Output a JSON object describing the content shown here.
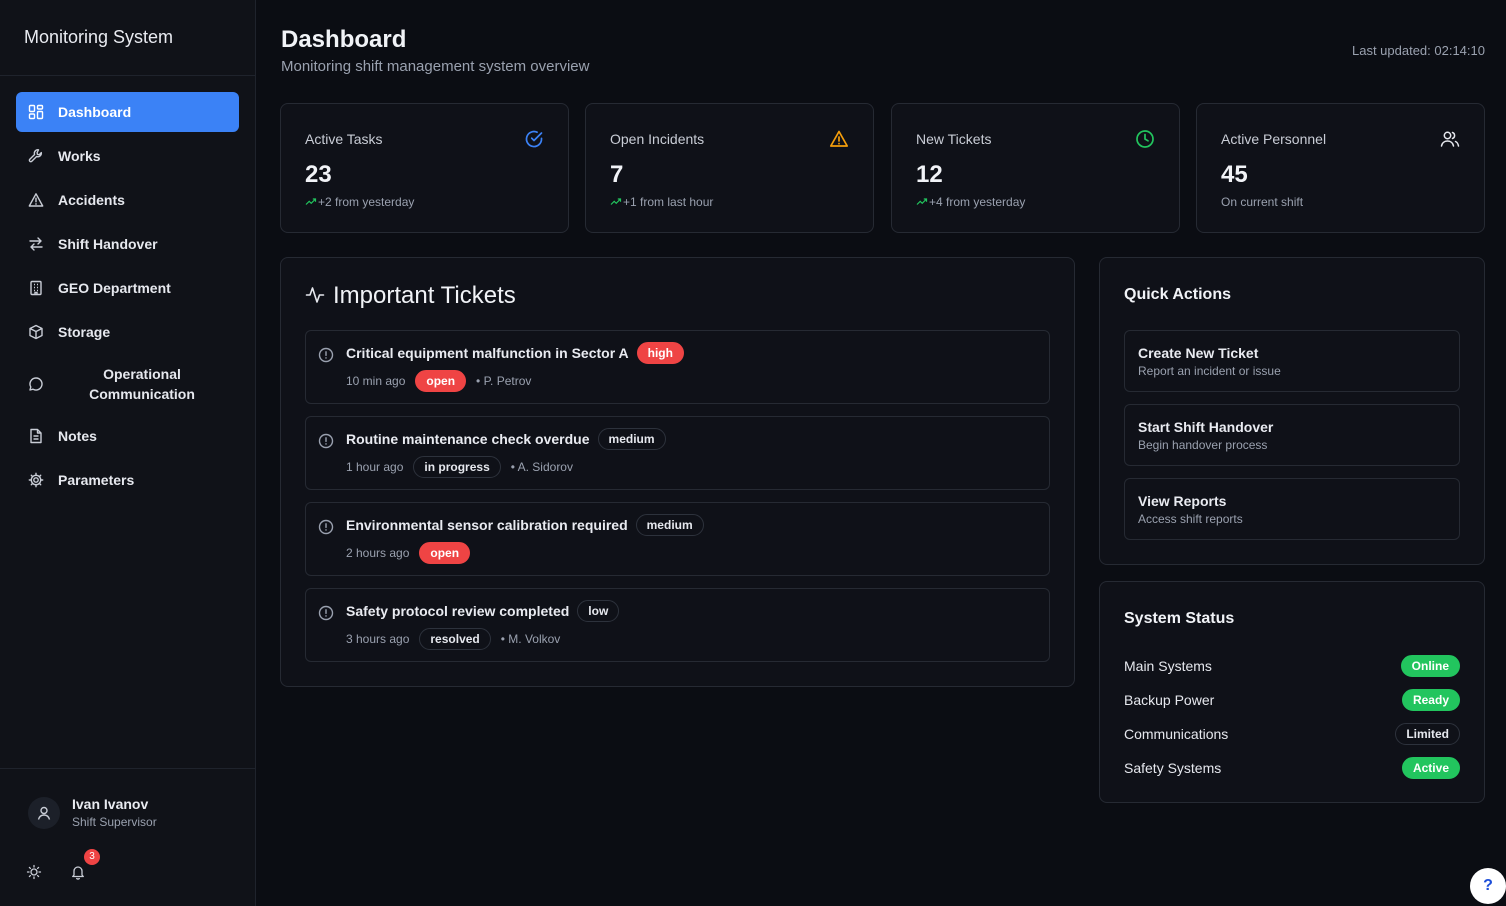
{
  "app": {
    "title": "Monitoring System"
  },
  "sidebar": {
    "items": [
      {
        "label": "Dashboard",
        "icon": "dashboard-icon",
        "active": true
      },
      {
        "label": "Works",
        "icon": "wrench-icon"
      },
      {
        "label": "Accidents",
        "icon": "warning-icon"
      },
      {
        "label": "Shift Handover",
        "icon": "arrows-swap-icon"
      },
      {
        "label": "GEO Department",
        "icon": "building-icon"
      },
      {
        "label": "Storage",
        "icon": "package-icon"
      },
      {
        "label": "Operational Communication",
        "icon": "message-icon"
      },
      {
        "label": "Notes",
        "icon": "document-icon"
      },
      {
        "label": "Parameters",
        "icon": "gear-icon"
      }
    ],
    "user": {
      "name": "Ivan Ivanov",
      "role": "Shift Supervisor"
    },
    "notifications_count": "3"
  },
  "header": {
    "title": "Dashboard",
    "subtitle": "Monitoring shift management system overview",
    "last_updated": "Last updated: 02:14:10"
  },
  "stats": [
    {
      "title": "Active Tasks",
      "value": "23",
      "sub": "+2 from yesterday",
      "trend": true,
      "icon": "check-circle-icon",
      "color": "#3b82f6"
    },
    {
      "title": "Open Incidents",
      "value": "7",
      "sub": "+1 from last hour",
      "trend": true,
      "icon": "warning-icon",
      "color": "#f59e0b"
    },
    {
      "title": "New Tickets",
      "value": "12",
      "sub": "+4 from yesterday",
      "trend": true,
      "icon": "clock-icon",
      "color": "#22c55e"
    },
    {
      "title": "Active Personnel",
      "value": "45",
      "sub": "On current shift",
      "trend": false,
      "icon": "users-icon",
      "color": "#e6e8ee"
    }
  ],
  "tickets": {
    "title": "Important Tickets",
    "items": [
      {
        "title": "Critical equipment malfunction in Sector A",
        "priority": "high",
        "priority_style": "red",
        "time": "10 min ago",
        "status": "open",
        "status_style": "red",
        "assignee": "• P. Petrov"
      },
      {
        "title": "Routine maintenance check overdue",
        "priority": "medium",
        "priority_style": "outline",
        "time": "1 hour ago",
        "status": "in progress",
        "status_style": "outline",
        "assignee": "• A. Sidorov"
      },
      {
        "title": "Environmental sensor calibration required",
        "priority": "medium",
        "priority_style": "outline",
        "time": "2 hours ago",
        "status": "open",
        "status_style": "red",
        "assignee": ""
      },
      {
        "title": "Safety protocol review completed",
        "priority": "low",
        "priority_style": "outline",
        "time": "3 hours ago",
        "status": "resolved",
        "status_style": "outline",
        "assignee": "• M. Volkov"
      }
    ]
  },
  "quick_actions": {
    "title": "Quick Actions",
    "items": [
      {
        "title": "Create New Ticket",
        "desc": "Report an incident or issue"
      },
      {
        "title": "Start Shift Handover",
        "desc": "Begin handover process"
      },
      {
        "title": "View Reports",
        "desc": "Access shift reports"
      }
    ]
  },
  "system_status": {
    "title": "System Status",
    "items": [
      {
        "label": "Main Systems",
        "status": "Online",
        "style": "green"
      },
      {
        "label": "Backup Power",
        "status": "Ready",
        "style": "green"
      },
      {
        "label": "Communications",
        "status": "Limited",
        "style": "outline"
      },
      {
        "label": "Safety Systems",
        "status": "Active",
        "style": "green"
      }
    ]
  },
  "help": {
    "label": "?"
  }
}
